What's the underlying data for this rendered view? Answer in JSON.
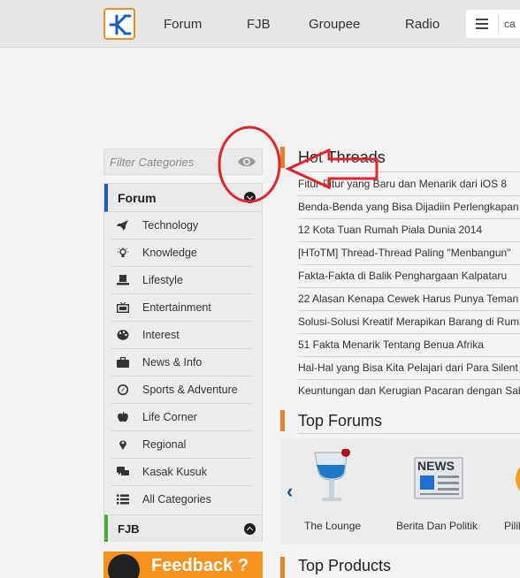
{
  "nav": {
    "logo": "K",
    "links": [
      "Forum",
      "FJB",
      "Groupee",
      "Radio"
    ],
    "search_text": "ca"
  },
  "sidebar": {
    "filter_placeholder": "Filter Categories",
    "forum_label": "Forum",
    "categories": [
      {
        "label": "Technology",
        "icon": "rocket-icon"
      },
      {
        "label": "Knowledge",
        "icon": "bulb-icon"
      },
      {
        "label": "Lifestyle",
        "icon": "hat-icon"
      },
      {
        "label": "Entertainment",
        "icon": "tv-icon"
      },
      {
        "label": "Interest",
        "icon": "palette-icon"
      },
      {
        "label": "News & Info",
        "icon": "briefcase-icon"
      },
      {
        "label": "Sports & Adventure",
        "icon": "compass-icon"
      },
      {
        "label": "Life Corner",
        "icon": "apple-icon"
      },
      {
        "label": "Regional",
        "icon": "pin-icon"
      },
      {
        "label": "Kasak Kusuk",
        "icon": "chat-icon"
      },
      {
        "label": "All Categories",
        "icon": "list-icon"
      }
    ],
    "fjb_label": "FJB",
    "feedback_label": "Feedback ?"
  },
  "hot_threads": {
    "title": "Hot Threads",
    "items": [
      "Fitur-Fitur yang Baru dan Menarik dari iOS 8",
      "Benda-Benda yang Bisa Dijadiin Perlengkapan",
      "12 Kota Tuan Rumah Piala Dunia 2014",
      "[HToTM] Thread-Thread Paling \"Menbangun\"",
      "Fakta-Fakta di Balik Penghargaan Kalpataru",
      "22 Alasan Kenapa Cewek Harus Punya Teman",
      "Solusi-Solusi Kreatif Merapikan Barang di Rumah",
      "51 Fakta Menarik Tentang Benua Afrika",
      "Hal-Hal yang Bisa Kita Pelajari dari Para Silent",
      "Keuntungan dan Kerugian Pacaran dengan Sahabat"
    ]
  },
  "top_forums": {
    "title": "Top Forums",
    "items": [
      {
        "label": "The Lounge",
        "icon": "lounge-glass-icon"
      },
      {
        "label": "Berita Dan Politik",
        "icon": "newspaper-icon",
        "badge": "NEWS"
      },
      {
        "label": "Pilih",
        "icon": "ballot-icon"
      }
    ]
  },
  "top_products": {
    "title": "Top Products"
  },
  "colors": {
    "accent": "#e3822a",
    "forum_blue": "#1c5fb8",
    "fjb_green": "#4aa83d",
    "annotation_red": "#e0262c"
  }
}
